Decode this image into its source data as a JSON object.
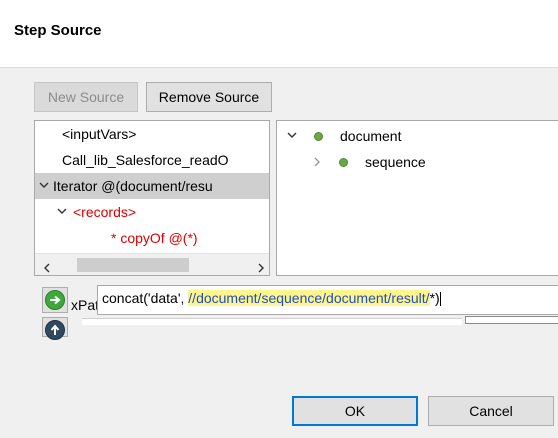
{
  "dialog": {
    "title": "Step Source"
  },
  "toolbar": {
    "new_source_label": "New Source",
    "remove_source_label": "Remove Source"
  },
  "left_tree": {
    "items": [
      {
        "label": "<inputVars>"
      },
      {
        "label": "Call_lib_Salesforce_readO"
      },
      {
        "label": "Iterator @(document/resu",
        "selected": true
      },
      {
        "label": "<records>"
      },
      {
        "label": "* copyOf @(*)"
      }
    ]
  },
  "right_tree": {
    "items": [
      {
        "label": "document",
        "expanded": true
      },
      {
        "label": "sequence",
        "expanded": false
      }
    ]
  },
  "xpath": {
    "label": "xPath",
    "value_prefix": "concat('data', ",
    "value_highlight": "//document/sequence/document/result/",
    "value_suffix": "*)"
  },
  "footer": {
    "ok_label": "OK",
    "cancel_label": "Cancel"
  },
  "colors": {
    "accent": "#0078d7",
    "status_green": "#6aa843",
    "error_red": "#e00000",
    "highlight": "#fff58a"
  }
}
